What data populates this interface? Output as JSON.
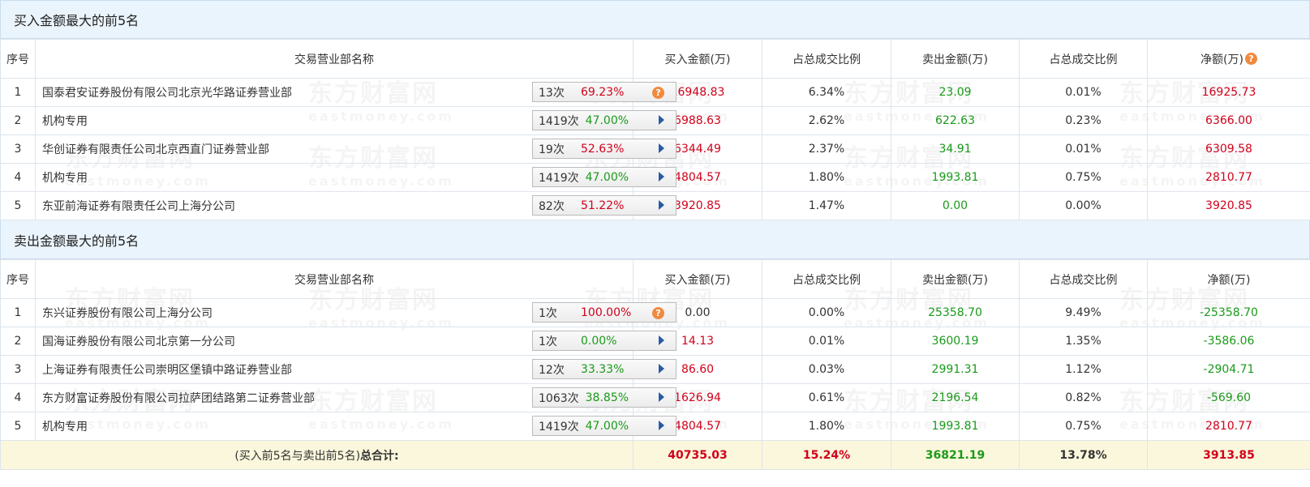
{
  "buy_section": {
    "title": "买入金额最大的前5名",
    "headers": [
      "序号",
      "交易营业部名称",
      "买入金额(万)",
      "占总成交比例",
      "卖出金额(万)",
      "占总成交比例",
      "净额(万)"
    ],
    "help_icon": "question-icon",
    "rows": [
      {
        "idx": "1",
        "name": "国泰君安证券股份有限公司北京光华路证券营业部",
        "times": "13次",
        "pct": "69.23%",
        "pct_color": "red",
        "action": "question-icon",
        "buy": "16948.83",
        "buy_ratio": "6.34%",
        "sell": "23.09",
        "sell_ratio": "0.01%",
        "net": "16925.73",
        "net_color": "red"
      },
      {
        "idx": "2",
        "name": "机构专用",
        "times": "1419次",
        "pct": "47.00%",
        "pct_color": "green",
        "action": "play-arrow-icon",
        "buy": "6988.63",
        "buy_ratio": "2.62%",
        "sell": "622.63",
        "sell_ratio": "0.23%",
        "net": "6366.00",
        "net_color": "red"
      },
      {
        "idx": "3",
        "name": "华创证券有限责任公司北京西直门证券营业部",
        "times": "19次",
        "pct": "52.63%",
        "pct_color": "red",
        "action": "play-arrow-icon",
        "buy": "6344.49",
        "buy_ratio": "2.37%",
        "sell": "34.91",
        "sell_ratio": "0.01%",
        "net": "6309.58",
        "net_color": "red"
      },
      {
        "idx": "4",
        "name": "机构专用",
        "times": "1419次",
        "pct": "47.00%",
        "pct_color": "green",
        "action": "play-arrow-icon",
        "buy": "4804.57",
        "buy_ratio": "1.80%",
        "sell": "1993.81",
        "sell_ratio": "0.75%",
        "net": "2810.77",
        "net_color": "red"
      },
      {
        "idx": "5",
        "name": "东亚前海证券有限责任公司上海分公司",
        "times": "82次",
        "pct": "51.22%",
        "pct_color": "red",
        "action": "play-arrow-icon",
        "buy": "3920.85",
        "buy_ratio": "1.47%",
        "sell": "0.00",
        "sell_ratio": "0.00%",
        "net": "3920.85",
        "net_color": "red"
      }
    ]
  },
  "sell_section": {
    "title": "卖出金额最大的前5名",
    "headers": [
      "序号",
      "交易营业部名称",
      "买入金额(万)",
      "占总成交比例",
      "卖出金额(万)",
      "占总成交比例",
      "净额(万)"
    ],
    "rows": [
      {
        "idx": "1",
        "name": "东兴证券股份有限公司上海分公司",
        "times": "1次",
        "pct": "100.00%",
        "pct_color": "red",
        "action": "question-icon",
        "buy": "0.00",
        "buy_color": "dark",
        "buy_ratio": "0.00%",
        "sell": "25358.70",
        "sell_ratio": "9.49%",
        "net": "-25358.70",
        "net_color": "green"
      },
      {
        "idx": "2",
        "name": "国海证券股份有限公司北京第一分公司",
        "times": "1次",
        "pct": "0.00%",
        "pct_color": "green",
        "action": "play-arrow-icon",
        "buy": "14.13",
        "buy_color": "red",
        "buy_ratio": "0.01%",
        "sell": "3600.19",
        "sell_ratio": "1.35%",
        "net": "-3586.06",
        "net_color": "green"
      },
      {
        "idx": "3",
        "name": "上海证券有限责任公司崇明区堡镇中路证券营业部",
        "times": "12次",
        "pct": "33.33%",
        "pct_color": "green",
        "action": "play-arrow-icon",
        "buy": "86.60",
        "buy_color": "red",
        "buy_ratio": "0.03%",
        "sell": "2991.31",
        "sell_ratio": "1.12%",
        "net": "-2904.71",
        "net_color": "green"
      },
      {
        "idx": "4",
        "name": "东方财富证券股份有限公司拉萨团结路第二证券营业部",
        "times": "1063次",
        "pct": "38.85%",
        "pct_color": "green",
        "action": "play-arrow-icon",
        "buy": "1626.94",
        "buy_color": "red",
        "buy_ratio": "0.61%",
        "sell": "2196.54",
        "sell_ratio": "0.82%",
        "net": "-569.60",
        "net_color": "green"
      },
      {
        "idx": "5",
        "name": "机构专用",
        "times": "1419次",
        "pct": "47.00%",
        "pct_color": "green",
        "action": "play-arrow-icon",
        "buy": "4804.57",
        "buy_color": "red",
        "buy_ratio": "1.80%",
        "sell": "1993.81",
        "sell_ratio": "0.75%",
        "net": "2810.77",
        "net_color": "red"
      }
    ]
  },
  "total": {
    "label_prefix": "(买入前5名与卖出前5名)",
    "label_bold": "总合计:",
    "buy": "40735.03",
    "buy_ratio": "15.24%",
    "sell": "36821.19",
    "sell_ratio": "13.78%",
    "net": "3913.85"
  },
  "watermark": {
    "text": "东方财富网",
    "sub": "eastmoney.com"
  },
  "colors": {
    "red": "#d0021b",
    "green": "#1a9a1a",
    "header_bg": "#eaf4fc",
    "total_bg": "#fbf7dc",
    "arrow": "#2b5aa3",
    "help": "#f08a3e"
  }
}
